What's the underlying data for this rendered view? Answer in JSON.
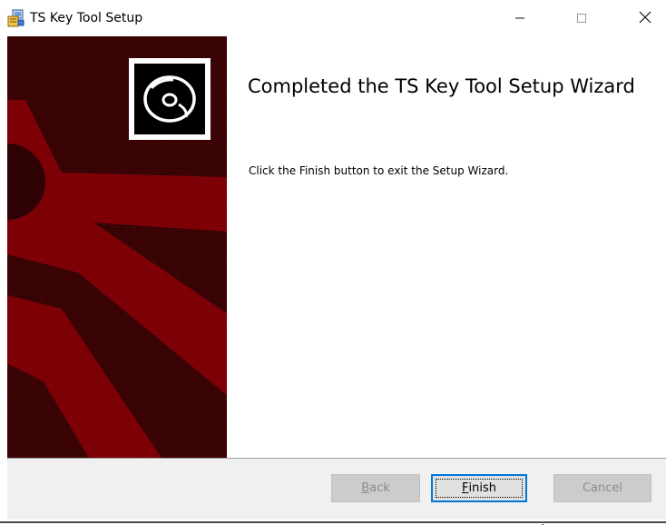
{
  "window": {
    "title": "TS Key Tool Setup",
    "icon": "installer-package-icon",
    "controls": [
      "minimize-icon",
      "maximize-icon",
      "close-icon"
    ]
  },
  "banner": {
    "icon": "cd-disc-icon",
    "background_color": "#3f0406",
    "accent_color": "#7a0006"
  },
  "main": {
    "heading": "Completed the TS Key Tool Setup Wizard",
    "body": "Click the Finish button to exit the Setup Wizard."
  },
  "buttons": {
    "back": {
      "mnemonic": "B",
      "rest": "ack",
      "enabled": false
    },
    "finish": {
      "mnemonic": "F",
      "rest": "inish",
      "enabled": true,
      "focused": true
    },
    "cancel": {
      "label": "Cancel",
      "enabled": false
    }
  },
  "colors": {
    "focus_border": "#0078d7",
    "button_face": "#e1e1e1",
    "footer_bg": "#f0f0f0"
  }
}
